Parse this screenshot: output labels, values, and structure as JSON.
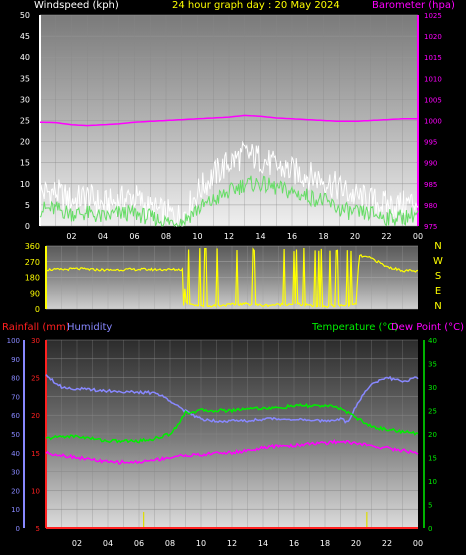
{
  "header": {
    "left": "Windspeed (kph)",
    "center": "24 hour graph day : 20 May 2024",
    "right": "Barometer (hpa)"
  },
  "colors": {
    "bg": "#000000",
    "wind_gust": "#ffffff",
    "wind_avg": "#66dd66",
    "barometer": "#ff00ff",
    "direction": "#ffff00",
    "rainfall": "#ff2020",
    "humidity": "#8888ff",
    "temperature": "#00ee00",
    "dewpoint": "#ff00ff",
    "title": "#ffff00"
  },
  "chart_data": [
    {
      "type": "line",
      "title": "24 hour graph day : 20 May 2024",
      "ylabel": "Windspeed (kph)",
      "y2label": "Barometer (hpa)",
      "ylim": [
        0,
        50
      ],
      "yticks": [
        0,
        5,
        10,
        15,
        20,
        25,
        30,
        35,
        40,
        45,
        50
      ],
      "y2lim": [
        975,
        1025
      ],
      "y2ticks": [
        975,
        980,
        985,
        990,
        995,
        1000,
        1005,
        1010,
        1015,
        1020,
        1025
      ],
      "xlim": [
        0,
        24
      ],
      "xticks": [
        "02",
        "04",
        "06",
        "08",
        "10",
        "12",
        "14",
        "16",
        "18",
        "20",
        "22",
        "00"
      ],
      "grid": true,
      "series": [
        {
          "name": "gust",
          "x": [
            0,
            1,
            2,
            3,
            4,
            5,
            6,
            7,
            8,
            9,
            10,
            11,
            12,
            13,
            14,
            15,
            16,
            17,
            18,
            19,
            20,
            21,
            22,
            23,
            24
          ],
          "values": [
            8,
            8,
            6,
            7,
            5,
            6,
            7,
            4,
            3,
            2,
            8,
            12,
            15,
            17,
            16,
            14,
            13,
            12,
            11,
            9,
            7,
            6,
            5,
            5,
            6
          ]
        },
        {
          "name": "average",
          "x": [
            0,
            1,
            2,
            3,
            4,
            5,
            6,
            7,
            8,
            9,
            10,
            11,
            12,
            13,
            14,
            15,
            16,
            17,
            18,
            19,
            20,
            21,
            22,
            23,
            24
          ],
          "values": [
            4,
            4,
            3,
            3,
            2,
            3,
            3,
            2,
            1,
            1,
            4,
            6,
            8,
            10,
            10,
            9,
            8,
            7,
            6,
            4,
            3,
            3,
            2,
            2,
            3
          ]
        },
        {
          "name": "barometer",
          "axis": "y2",
          "x": [
            0,
            1,
            2,
            3,
            4,
            5,
            6,
            7,
            8,
            9,
            10,
            11,
            12,
            13,
            14,
            15,
            16,
            17,
            18,
            19,
            20,
            21,
            22,
            23,
            24
          ],
          "values": [
            999.6,
            999.5,
            999,
            998.8,
            999,
            999.2,
            999.6,
            999.8,
            1000,
            1000.2,
            1000.4,
            1000.6,
            1000.8,
            1001.2,
            1001,
            1000.6,
            1000.4,
            1000.2,
            1000,
            999.8,
            999.8,
            1000,
            1000.2,
            1000.4,
            1000.4
          ]
        }
      ]
    },
    {
      "type": "scatter",
      "ylabel": "Wind direction",
      "ylim": [
        0,
        360
      ],
      "yticks": [
        0,
        90,
        180,
        270,
        360
      ],
      "compass": [
        "N",
        "W",
        "S",
        "E",
        "N"
      ],
      "xlim": [
        0,
        24
      ],
      "grid": true,
      "series": [
        {
          "name": "direction",
          "x": [
            0,
            1,
            2,
            3,
            4,
            5,
            6,
            7,
            8,
            8.9,
            9,
            10,
            11,
            12,
            13,
            14,
            15,
            16,
            17,
            18,
            19,
            20,
            20.2,
            21,
            22,
            23,
            24
          ],
          "values": [
            225,
            225,
            230,
            225,
            222,
            225,
            226,
            225,
            225,
            225,
            40,
            15,
            20,
            25,
            30,
            20,
            25,
            30,
            20,
            15,
            20,
            25,
            305,
            290,
            240,
            220,
            215
          ]
        }
      ]
    },
    {
      "type": "line",
      "y_rain_label": "Rainfall (mm)",
      "y_hum_label": "Humidity",
      "y_temp_label": "Temperature (°C)",
      "y_dew_label": "Dew Point (°C)",
      "rain_lim": [
        5,
        30
      ],
      "rain_ticks": [
        5,
        10,
        15,
        20,
        25,
        30
      ],
      "hum_lim": [
        0,
        100
      ],
      "hum_ticks": [
        0,
        10,
        20,
        30,
        40,
        50,
        60,
        70,
        80,
        90,
        100
      ],
      "temp_lim": [
        0,
        40
      ],
      "temp_ticks": [
        0,
        5,
        10,
        15,
        20,
        25,
        30,
        35,
        40
      ],
      "xlim": [
        0,
        24
      ],
      "xticks": [
        "02",
        "04",
        "06",
        "08",
        "10",
        "12",
        "14",
        "16",
        "18",
        "20",
        "22",
        "00"
      ],
      "grid": true,
      "series": [
        {
          "name": "humidity",
          "x": [
            0,
            0.5,
            1,
            2,
            4,
            6,
            7,
            8,
            9,
            10,
            11,
            12,
            13,
            14,
            15,
            16,
            17,
            18,
            19,
            19.5,
            20,
            21,
            22,
            23,
            24
          ],
          "values": [
            82,
            78,
            75,
            74,
            73,
            72,
            72,
            68,
            62,
            58,
            57,
            57,
            57,
            58,
            58,
            58,
            57,
            57,
            58,
            56,
            65,
            77,
            80,
            78,
            80
          ]
        },
        {
          "name": "temperature",
          "axis": "temp",
          "x": [
            0,
            1,
            2,
            3,
            4,
            5,
            6,
            7,
            8,
            8.5,
            9,
            10,
            11,
            12,
            13,
            14,
            15,
            16,
            17,
            18,
            19,
            20,
            21,
            22,
            23,
            24
          ],
          "values": [
            19,
            19.5,
            19.5,
            19,
            18.5,
            18.5,
            18.5,
            19,
            20,
            22,
            24.5,
            25,
            25,
            25,
            25.5,
            25.5,
            25.5,
            26,
            26,
            26,
            25.5,
            23.5,
            21.5,
            21,
            20.5,
            20
          ]
        },
        {
          "name": "dewpoint",
          "axis": "temp",
          "x": [
            0,
            1,
            2,
            3,
            4,
            5,
            6,
            7,
            8,
            9,
            10,
            11,
            12,
            13,
            14,
            15,
            16,
            17,
            18,
            19,
            20,
            21,
            22,
            23,
            24
          ],
          "values": [
            16,
            15.5,
            15,
            14.5,
            14,
            14,
            14,
            14.5,
            15,
            15.5,
            15.5,
            16,
            16,
            16.5,
            17,
            17.5,
            17.5,
            18,
            18,
            18.5,
            18,
            17.5,
            17,
            16.5,
            16
          ]
        },
        {
          "name": "rainfall",
          "axis": "rain",
          "x": [
            0,
            24
          ],
          "values": [
            5,
            5
          ]
        }
      ],
      "rain_markers": [
        6.3,
        20.7
      ]
    }
  ]
}
